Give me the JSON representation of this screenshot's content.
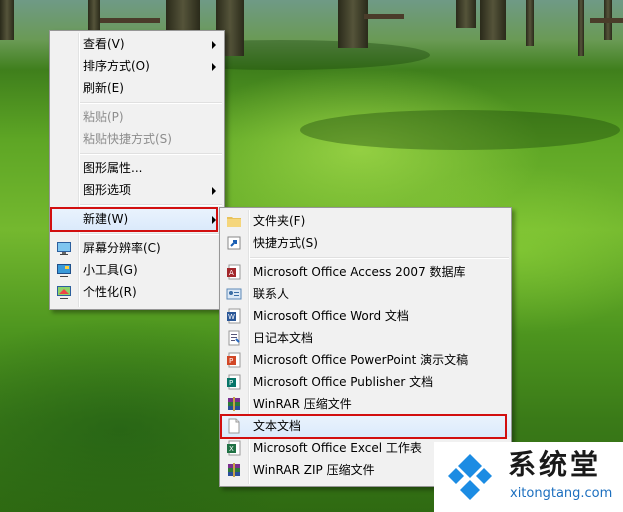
{
  "context_menu": {
    "items": [
      {
        "label": "查看(V)",
        "has_submenu": true,
        "enabled": true
      },
      {
        "label": "排序方式(O)",
        "has_submenu": true,
        "enabled": true
      },
      {
        "label": "刷新(E)",
        "has_submenu": false,
        "enabled": true
      },
      {
        "label": "粘贴(P)",
        "has_submenu": false,
        "enabled": false
      },
      {
        "label": "粘贴快捷方式(S)",
        "has_submenu": false,
        "enabled": false
      },
      {
        "label": "图形属性...",
        "has_submenu": false,
        "enabled": true
      },
      {
        "label": "图形选项",
        "has_submenu": true,
        "enabled": true
      },
      {
        "label": "新建(W)",
        "has_submenu": true,
        "enabled": true,
        "highlighted": true
      },
      {
        "label": "屏幕分辨率(C)",
        "icon": "monitor-icon",
        "enabled": true
      },
      {
        "label": "小工具(G)",
        "icon": "gadgets-icon",
        "enabled": true
      },
      {
        "label": "个性化(R)",
        "icon": "personalize-icon",
        "enabled": true
      }
    ]
  },
  "new_submenu": {
    "items": [
      {
        "label": "文件夹(F)",
        "icon": "folder-icon"
      },
      {
        "label": "快捷方式(S)",
        "icon": "shortcut-icon"
      },
      {
        "label": "Microsoft Office Access 2007 数据库",
        "icon": "access-icon"
      },
      {
        "label": "联系人",
        "icon": "contact-icon"
      },
      {
        "label": "Microsoft Office Word 文档",
        "icon": "word-icon"
      },
      {
        "label": "日记本文档",
        "icon": "journal-icon"
      },
      {
        "label": "Microsoft Office PowerPoint 演示文稿",
        "icon": "powerpoint-icon"
      },
      {
        "label": "Microsoft Office Publisher 文档",
        "icon": "publisher-icon"
      },
      {
        "label": "WinRAR 压缩文件",
        "icon": "winrar-icon"
      },
      {
        "label": "文本文档",
        "icon": "text-document-icon",
        "highlighted": true
      },
      {
        "label": "Microsoft Office Excel 工作表",
        "icon": "excel-icon"
      },
      {
        "label": "WinRAR ZIP 压缩文件",
        "icon": "winrar-zip-icon"
      }
    ]
  },
  "watermark": {
    "name": "系统堂",
    "url": "xitongtang.com"
  },
  "colors": {
    "highlight_border": "#d20f0f",
    "menu_bg": "#f1f1f1",
    "logo_blue": "#1c8ce3"
  }
}
